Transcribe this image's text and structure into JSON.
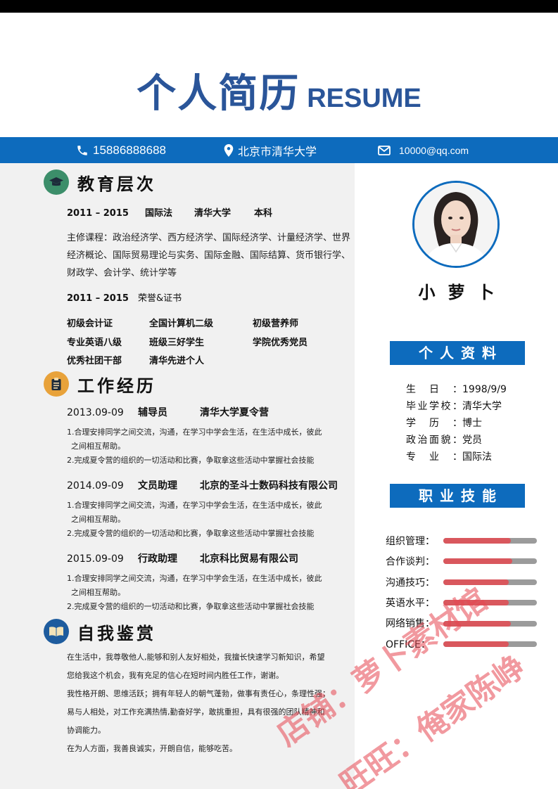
{
  "header": {
    "title_cn": "个人简历",
    "title_en": "RESUME"
  },
  "contact": {
    "phone": "15886888688",
    "address": "北京市清华大学",
    "email": "10000@qq.com"
  },
  "education": {
    "title": "教育层次",
    "row1": {
      "years": "2011 – 2015",
      "major": "国际法",
      "school": "清华大学",
      "degree": "本科"
    },
    "courses": "主修课程：政治经济学、西方经济学、国际经济学、计量经济学、世界经济概论、国际贸易理论与实务、国际金融、国际结算、货币银行学、财政学、会计学、统计学等",
    "row2": {
      "years": "2011 – 2015",
      "label": "荣誉&证书"
    },
    "certs": [
      "初级会计证",
      "全国计算机二级",
      "初级营养师",
      "专业英语八级",
      "班级三好学生",
      "学院优秀党员",
      "优秀社团干部",
      "清华先进个人"
    ]
  },
  "work": {
    "title": "工作经历",
    "jobs": [
      {
        "date": "2013.09-09",
        "role": "辅导员",
        "company": "清华大学夏令营",
        "desc1a": "1.合理安排同学之间交流，沟通，在学习中学会生活，在生活中成长，彼此",
        "desc1b": "之间相互帮助。",
        "desc2": "2.完成夏令营的组织的一切活动和比赛，争取拿这些活动中掌握社会技能"
      },
      {
        "date": "2014.09-09",
        "role": "文员助理",
        "company": "北京的圣斗士数码科技有限公司",
        "desc1a": "1.合理安排同学之间交流，沟通，在学习中学会生活，在生活中成长，彼此",
        "desc1b": "之间相互帮助。",
        "desc2": "2.完成夏令营的组织的一切活动和比赛，争取拿这些活动中掌握社会技能"
      },
      {
        "date": "2015.09-09",
        "role": "行政助理",
        "company": "北京科比贸易有限公司",
        "desc1a": "1.合理安排同学之间交流，沟通，在学习中学会生活，在生活中成长，彼此",
        "desc1b": "之间相互帮助。",
        "desc2": "2.完成夏令营的组织的一切活动和比赛，争取拿这些活动中掌握社会技能"
      }
    ]
  },
  "self": {
    "title": "自我鉴赏",
    "lines": [
      "在生活中，我尊敬他人,能够和别人友好相处，我擅长快速学习新知识，希望",
      "您给我这个机会，我有充足的信心在短时间内胜任工作，谢谢。",
      "我性格开朗、思维活跃；拥有年轻人的朝气蓬勃，做事有责任心，条理性强；",
      "易与人相处，对工作充满热情,勤奋好学，敢挑重担，具有很强的团队精神和",
      "协调能力。",
      "在为人方面，我善良诚实，开朗自信，能够吃苦。"
    ]
  },
  "profile": {
    "name": "小萝卜",
    "info_title": "个人资料",
    "info": [
      {
        "key": "生日：",
        "value": "1998/9/9"
      },
      {
        "key": "毕业学校：",
        "value": "清华大学"
      },
      {
        "key": "学历：",
        "value": "博士"
      },
      {
        "key": "政治面貌：",
        "value": "党员"
      },
      {
        "key": "专业：",
        "value": "国际法"
      }
    ],
    "skills_title": "职业技能",
    "skills": [
      {
        "name": "组织管理：",
        "level": 0.72
      },
      {
        "name": "合作谈判：",
        "level": 0.74
      },
      {
        "name": "沟通技巧：",
        "level": 0.7
      },
      {
        "name": "英语水平：",
        "level": 0.7
      },
      {
        "name": "网络销售：",
        "level": 0.72
      },
      {
        "name": "OFFICE：",
        "level": 0.7
      }
    ],
    "skill_fill_color": "#d9575d",
    "skill_track_color": "#9b9b9b"
  },
  "watermark": {
    "line1": "店铺：萝卜素材馆",
    "line2": "旺旺：俺家陈峥"
  },
  "colors": {
    "accent": "#0d6bbd",
    "title": "#2a5599"
  }
}
